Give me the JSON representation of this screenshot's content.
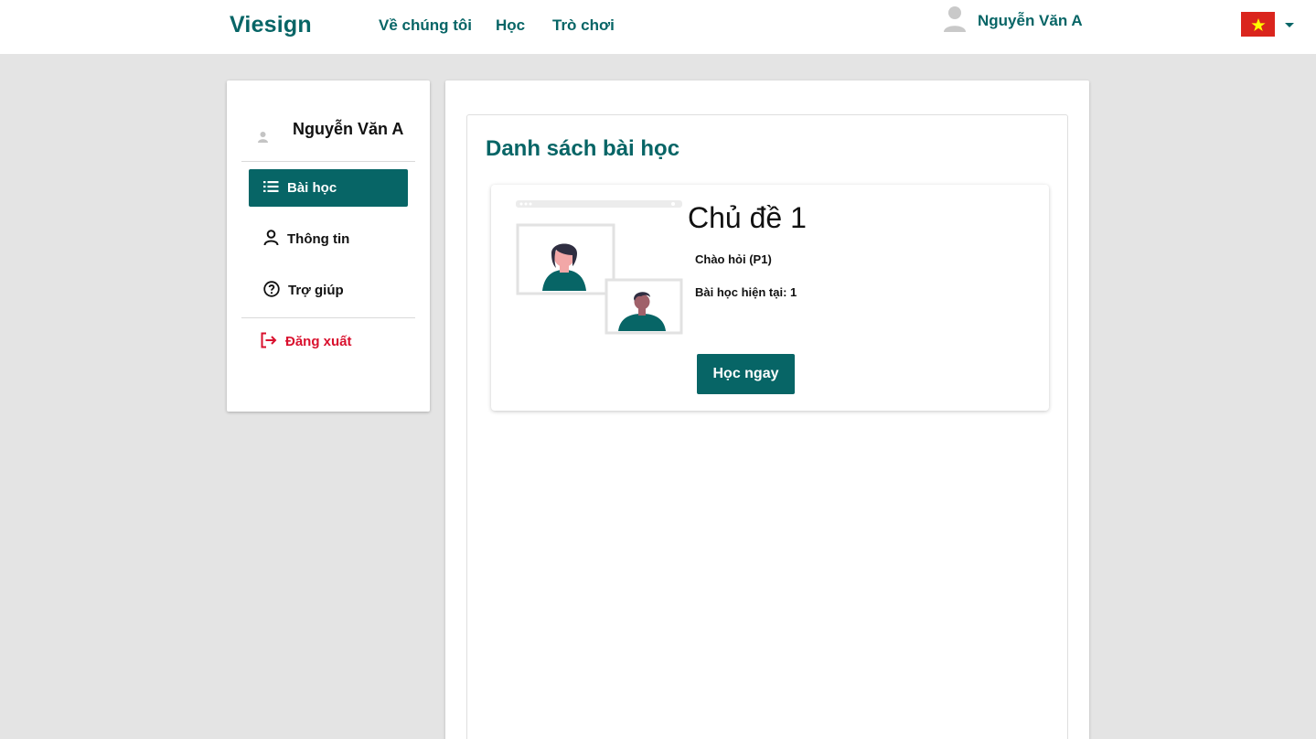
{
  "navbar": {
    "brand": "Viesign",
    "links": [
      "Về chúng tôi",
      "Học",
      "Trò chơi"
    ],
    "user_name": "Nguyễn Văn A",
    "user_icon": "user-avatar-icon",
    "language_flag": "vietnam-flag-icon",
    "language_caret": "caret-down-icon"
  },
  "sidebar": {
    "avatar_icon": "user-avatar-icon",
    "user_name": "Nguyễn Văn A",
    "items": [
      {
        "label": "Bài học",
        "icon": "list-icon",
        "active": true
      },
      {
        "label": "Thông tin",
        "icon": "person-icon",
        "active": false
      },
      {
        "label": "Trợ giúp",
        "icon": "help-circle-icon",
        "active": false
      }
    ],
    "logout": {
      "label": "Đăng xuất",
      "icon": "logout-icon"
    }
  },
  "main": {
    "title": "Danh sách bài học",
    "cards": [
      {
        "illustration": "video-call-illustration",
        "topic": "Chủ đề 1",
        "lesson": "Chào hỏi (P1)",
        "current_lesson": "Bài học hiện tại: 1",
        "button_label": "Học ngay"
      }
    ]
  },
  "colors": {
    "primary": "#076566",
    "logout": "#d9112e",
    "background": "#e4e4e4",
    "flag_red": "#da251d",
    "flag_star": "#ffff00"
  }
}
